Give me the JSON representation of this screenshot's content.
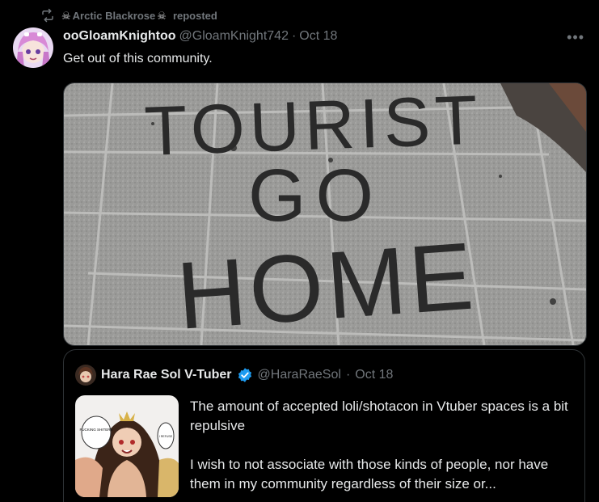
{
  "repost": {
    "icon": "repost-icon",
    "reposter_name": "Arctic Blackrose",
    "decor_glyph": "☠",
    "suffix": "reposted"
  },
  "tweet": {
    "avatar": "anime-girl-avatar",
    "display_name": "ooGloamKnightoo",
    "handle": "@GloamKnight742",
    "separator": "·",
    "date": "Oct 18",
    "more_icon": "•••",
    "text": "Get out of this community.",
    "media_alt": "Sidewalk paving stones with spray-painted graffiti",
    "graffiti_lines": [
      "TOURIST",
      "GO",
      "HOME"
    ]
  },
  "quote": {
    "display_name": "Hara Rae Sol V-Tuber",
    "verified": true,
    "handle": "@HaraRaeSol",
    "separator": "·",
    "date": "Oct 18",
    "thumb_bubble_1": "FUCKING SHITERS",
    "thumb_bubble_2": "I REFUSE",
    "paragraph_1": "The amount of accepted loli/shotacon in Vtuber spaces is a bit repulsive",
    "paragraph_2": "I wish to not associate with those kinds of people, nor have them in my community regardless of their size or..."
  },
  "colors": {
    "background": "#000000",
    "text_primary": "#e7e9ea",
    "text_secondary": "#71767b",
    "border": "#2f3336",
    "verified_blue": "#1d9bf0"
  }
}
